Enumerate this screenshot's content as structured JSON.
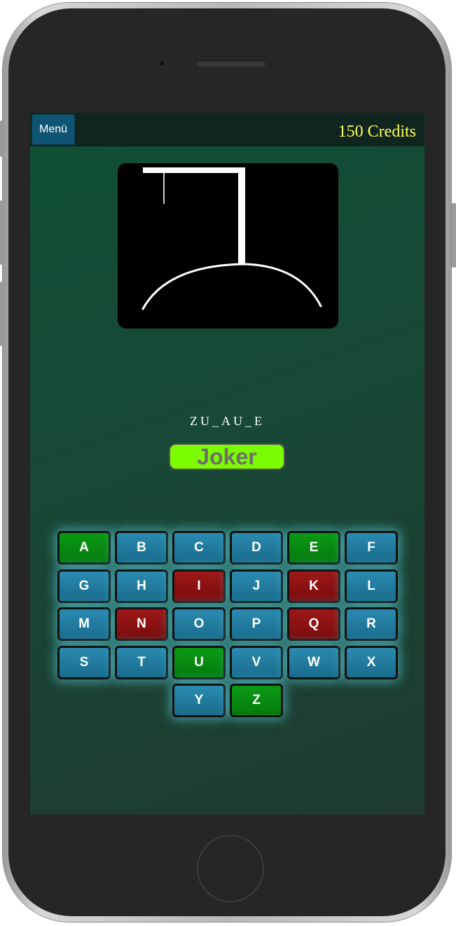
{
  "header": {
    "menu_label": "Menü",
    "credits_text": "150 Credits"
  },
  "game": {
    "word_display": "ZU_AU_E",
    "joker_label": "Joker",
    "hangman_stage": "gallows"
  },
  "colors": {
    "correct": "#0a9a14",
    "wrong": "#9e1818",
    "unused": "#2a8bb0",
    "joker": "#7cfc00",
    "credits": "#ffff55"
  },
  "keyboard": {
    "keys": [
      {
        "letter": "A",
        "state": "correct"
      },
      {
        "letter": "B",
        "state": "unused"
      },
      {
        "letter": "C",
        "state": "unused"
      },
      {
        "letter": "D",
        "state": "unused"
      },
      {
        "letter": "E",
        "state": "correct"
      },
      {
        "letter": "F",
        "state": "unused"
      },
      {
        "letter": "G",
        "state": "unused"
      },
      {
        "letter": "H",
        "state": "unused"
      },
      {
        "letter": "I",
        "state": "wrong"
      },
      {
        "letter": "J",
        "state": "unused"
      },
      {
        "letter": "K",
        "state": "wrong"
      },
      {
        "letter": "L",
        "state": "unused"
      },
      {
        "letter": "M",
        "state": "unused"
      },
      {
        "letter": "N",
        "state": "wrong"
      },
      {
        "letter": "O",
        "state": "unused"
      },
      {
        "letter": "P",
        "state": "unused"
      },
      {
        "letter": "Q",
        "state": "wrong"
      },
      {
        "letter": "R",
        "state": "unused"
      },
      {
        "letter": "S",
        "state": "unused"
      },
      {
        "letter": "T",
        "state": "unused"
      },
      {
        "letter": "U",
        "state": "correct"
      },
      {
        "letter": "V",
        "state": "unused"
      },
      {
        "letter": "W",
        "state": "unused"
      },
      {
        "letter": "X",
        "state": "unused"
      },
      {
        "letter": "Y",
        "state": "unused"
      },
      {
        "letter": "Z",
        "state": "correct"
      }
    ]
  }
}
